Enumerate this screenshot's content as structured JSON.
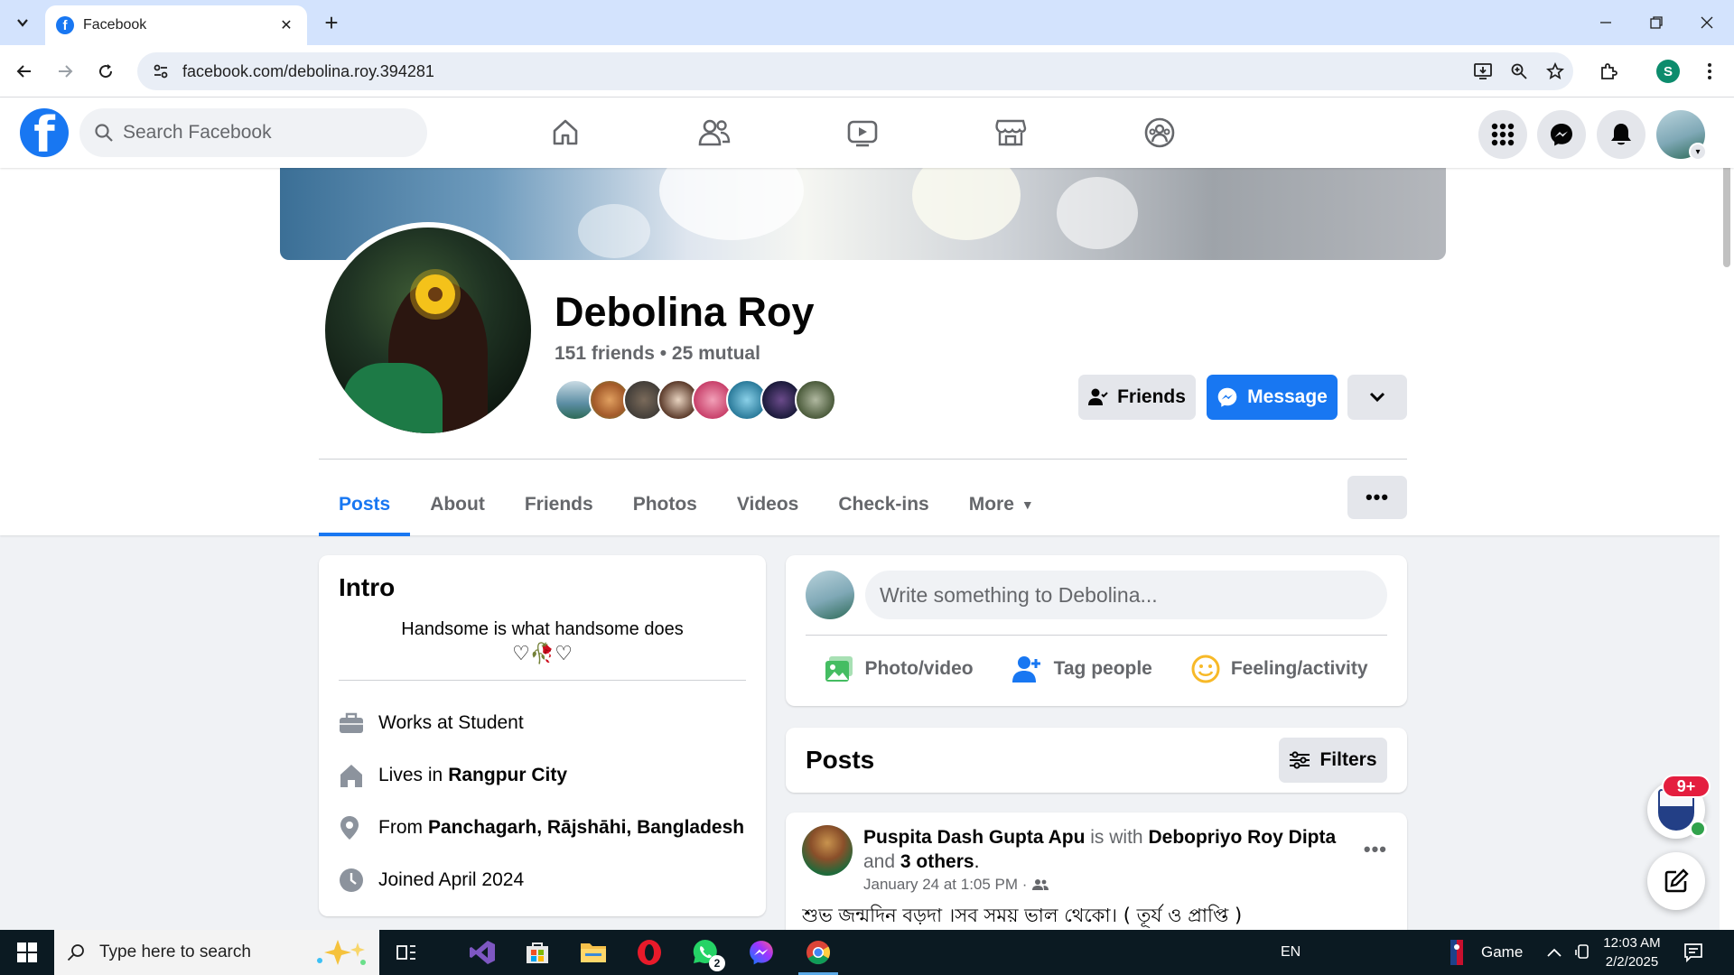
{
  "browser": {
    "tab_title": "Facebook",
    "url": "facebook.com/debolina.roy.394281",
    "profile_initial": "S"
  },
  "fb": {
    "logo_letter": "f",
    "search_placeholder": "Search Facebook",
    "brand_color": "#1877f2"
  },
  "profile": {
    "name": "Debolina Roy",
    "friends_summary": "151 friends • 25 mutual",
    "buttons": {
      "friends": "Friends",
      "message": "Message"
    },
    "tabs": [
      "Posts",
      "About",
      "Friends",
      "Photos",
      "Videos",
      "Check-ins",
      "More"
    ],
    "active_tab": "Posts"
  },
  "intro": {
    "title": "Intro",
    "bio": "Handsome is what handsome does",
    "bio_icons": "♡🥀♡",
    "rows": [
      {
        "icon": "briefcase-icon",
        "text": "Works at Student",
        "bold": ""
      },
      {
        "icon": "home-icon",
        "text": "Lives in",
        "bold": "Rangpur City"
      },
      {
        "icon": "location-pin-icon",
        "text": "From",
        "bold": "Panchagarh, Rājshāhi, Bangladesh"
      },
      {
        "icon": "clock-icon",
        "text": "Joined April 2024",
        "bold": ""
      }
    ]
  },
  "composer": {
    "placeholder": "Write something to Debolina...",
    "actions": [
      "Photo/video",
      "Tag people",
      "Feeling/activity"
    ]
  },
  "posts_header": {
    "title": "Posts",
    "filters_label": "Filters"
  },
  "post": {
    "author": "Puspita Dash Gupta Apu",
    "with_text": "is with",
    "tagged": "Debopriyo Roy Dipta",
    "and_text": "and",
    "others": "3 others",
    "time": "January 24 at 1:05 PM ·",
    "text": "শুভ জন্মদিন বড়দা ।সব সময় ভাল থেকো। ( তূর্য ও প্রাপ্তি )"
  },
  "chat": {
    "badge": "9+"
  },
  "taskbar": {
    "search_placeholder": "Type here to search",
    "whatsapp_badge": "2",
    "lang": "EN",
    "game_label": "Game",
    "time": "12:03 AM",
    "date": "2/2/2025"
  }
}
